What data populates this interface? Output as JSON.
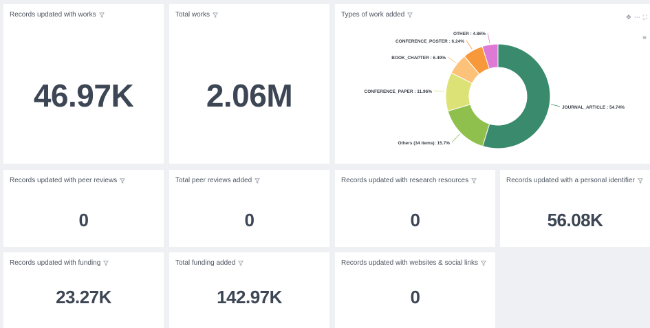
{
  "tiles": {
    "records_with_works": {
      "title": "Records updated with works",
      "value": "46.97K"
    },
    "total_works": {
      "title": "Total works",
      "value": "2.06M"
    },
    "types_of_work": {
      "title": "Types of work added"
    },
    "peer_reviews": {
      "title": "Records updated with peer reviews",
      "value": "0"
    },
    "total_peer_reviews": {
      "title": "Total peer reviews added",
      "value": "0"
    },
    "research_resources": {
      "title": "Records updated with research resources",
      "value": "0"
    },
    "personal_identifier": {
      "title": "Records updated with a personal identifier",
      "value": "56.08K"
    },
    "funding": {
      "title": "Records updated with funding",
      "value": "23.27K"
    },
    "total_funding": {
      "title": "Total funding added",
      "value": "142.97K"
    },
    "websites": {
      "title": "Records updated with websites & social links",
      "value": "0"
    }
  },
  "icons": {
    "filter": "filter-icon",
    "move": "move-icon",
    "more": "more-icon",
    "expand": "expand-icon",
    "menu": "hamburger-menu-icon"
  },
  "chart_data": {
    "type": "pie",
    "title": "Types of work added",
    "categories": [
      "JOURNAL_ARTICLE",
      "Others (34 items)",
      "CONFERENCE_PAPER",
      "BOOK_CHAPTER",
      "CONFERENCE_POSTER",
      "OTHER"
    ],
    "values": [
      54.74,
      15.7,
      11.96,
      6.49,
      6.24,
      4.86
    ],
    "labels": [
      "JOURNAL_ARTICLE : 54.74%",
      "Others (34 items): 15.7%",
      "CONFERENCE_PAPER : 11.96%",
      "BOOK_CHAPTER : 6.49%",
      "CONFERENCE_POSTER : 6.24%",
      "OTHER : 4.86%"
    ],
    "colors": [
      "#3a8a6e",
      "#8fc04d",
      "#dce275",
      "#fcc27a",
      "#f7983a",
      "#de7ad6"
    ],
    "donut": true
  }
}
